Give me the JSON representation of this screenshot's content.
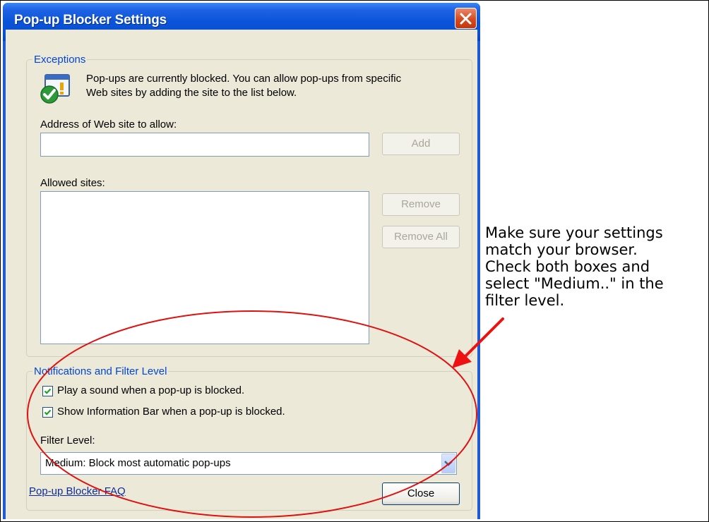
{
  "window": {
    "title": "Pop-up Blocker Settings",
    "close_icon": "close-icon"
  },
  "exceptions": {
    "legend": "Exceptions",
    "info_icon": "popup-blocked-check-icon",
    "info_line1": "Pop-ups are currently blocked.  You can allow pop-ups from specific",
    "info_line2": "Web sites by adding the site to the list below.",
    "address_label": "Address of Web site to allow:",
    "address_value": "",
    "add_button": "Add",
    "allowed_label": "Allowed sites:",
    "allowed_sites": [],
    "remove_button": "Remove",
    "remove_all_button": "Remove All"
  },
  "notifications": {
    "legend": "Notifications and Filter Level",
    "play_sound": {
      "label": "Play a sound when a pop-up is blocked.",
      "checked": true
    },
    "show_info_bar": {
      "label": "Show Information Bar when a pop-up is blocked.",
      "checked": true
    },
    "filter_label": "Filter Level:",
    "filter_value": "Medium: Block most automatic pop-ups"
  },
  "footer": {
    "faq_link": "Pop-up Blocker FAQ",
    "close_button": "Close"
  },
  "annotation": {
    "note": "Make sure your settings\nmatch your browser.\nCheck both boxes and\nselect \"Medium..\" in the\nfilter level.",
    "circle_color": "#e01010",
    "arrow_color": "#ee1111"
  }
}
